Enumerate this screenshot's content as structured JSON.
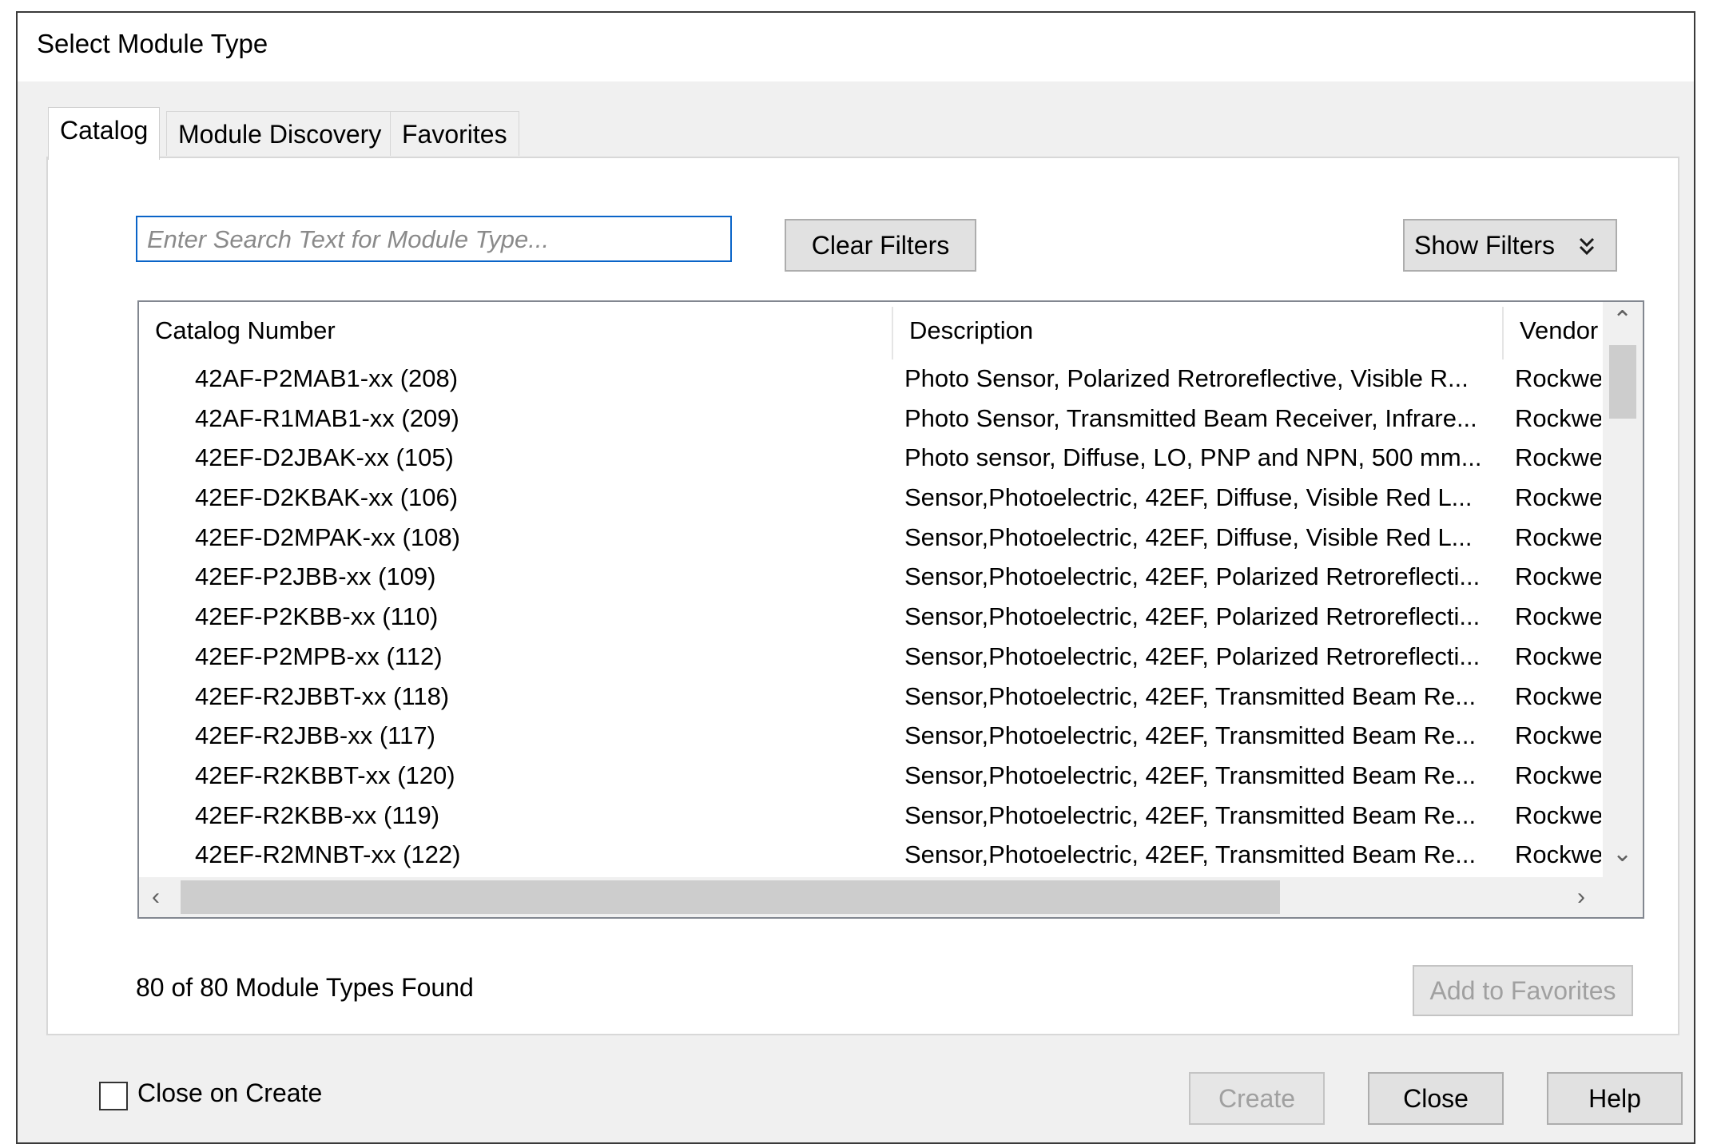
{
  "window": {
    "title": "Select Module Type"
  },
  "tabs": [
    {
      "label": "Catalog",
      "active": true
    },
    {
      "label": "Module Discovery",
      "active": false
    },
    {
      "label": "Favorites",
      "active": false
    }
  ],
  "search": {
    "placeholder": "Enter Search Text for Module Type...",
    "value": ""
  },
  "toolbar": {
    "clear_filters_label": "Clear Filters",
    "show_filters_label": "Show Filters",
    "show_filters_icon": "double-chevron-down-icon"
  },
  "table": {
    "columns": [
      "Catalog Number",
      "Description",
      "Vendor"
    ],
    "rows": [
      {
        "catalog": "42AF-P2MAB1-xx (208)",
        "description": "Photo Sensor, Polarized Retroreflective,  Visible R...",
        "vendor": "Rockwe"
      },
      {
        "catalog": "42AF-R1MAB1-xx (209)",
        "description": "Photo Sensor, Transmitted Beam Receiver,  Infrare...",
        "vendor": "Rockwe"
      },
      {
        "catalog": "42EF-D2JBAK-xx (105)",
        "description": "Photo sensor, Diffuse, LO, PNP and NPN, 500 mm...",
        "vendor": "Rockwe"
      },
      {
        "catalog": "42EF-D2KBAK-xx (106)",
        "description": "Sensor,Photoelectric, 42EF, Diffuse, Visible Red L...",
        "vendor": "Rockwe"
      },
      {
        "catalog": "42EF-D2MPAK-xx (108)",
        "description": "Sensor,Photoelectric, 42EF, Diffuse, Visible Red L...",
        "vendor": "Rockwe"
      },
      {
        "catalog": "42EF-P2JBB-xx (109)",
        "description": "Sensor,Photoelectric, 42EF, Polarized Retroreflecti...",
        "vendor": "Rockwe"
      },
      {
        "catalog": "42EF-P2KBB-xx (110)",
        "description": "Sensor,Photoelectric, 42EF, Polarized Retroreflecti...",
        "vendor": "Rockwe"
      },
      {
        "catalog": "42EF-P2MPB-xx (112)",
        "description": "Sensor,Photoelectric, 42EF, Polarized Retroreflecti...",
        "vendor": "Rockwe"
      },
      {
        "catalog": "42EF-R2JBBT-xx (118)",
        "description": "Sensor,Photoelectric, 42EF, Transmitted Beam Re...",
        "vendor": "Rockwe"
      },
      {
        "catalog": "42EF-R2JBB-xx (117)",
        "description": "Sensor,Photoelectric, 42EF, Transmitted Beam Re...",
        "vendor": "Rockwe"
      },
      {
        "catalog": "42EF-R2KBBT-xx (120)",
        "description": "Sensor,Photoelectric, 42EF, Transmitted Beam Re...",
        "vendor": "Rockwe"
      },
      {
        "catalog": "42EF-R2KBB-xx (119)",
        "description": "Sensor,Photoelectric, 42EF, Transmitted Beam Re...",
        "vendor": "Rockwe"
      },
      {
        "catalog": "42EF-R2MNBT-xx (122)",
        "description": "Sensor,Photoelectric, 42EF, Transmitted Beam Re...",
        "vendor": "Rockwe"
      }
    ]
  },
  "status": {
    "text": "80 of 80 Module Types Found"
  },
  "add_to_favorites_label": "Add to Favorites",
  "footer": {
    "close_on_create_label": "Close on Create",
    "close_on_create_checked": false,
    "create_label": "Create",
    "close_label": "Close",
    "help_label": "Help"
  },
  "colors": {
    "focus_border": "#0a64c8",
    "dialog_background": "#f0f0f0",
    "disabled_text": "#a0a0a0"
  }
}
